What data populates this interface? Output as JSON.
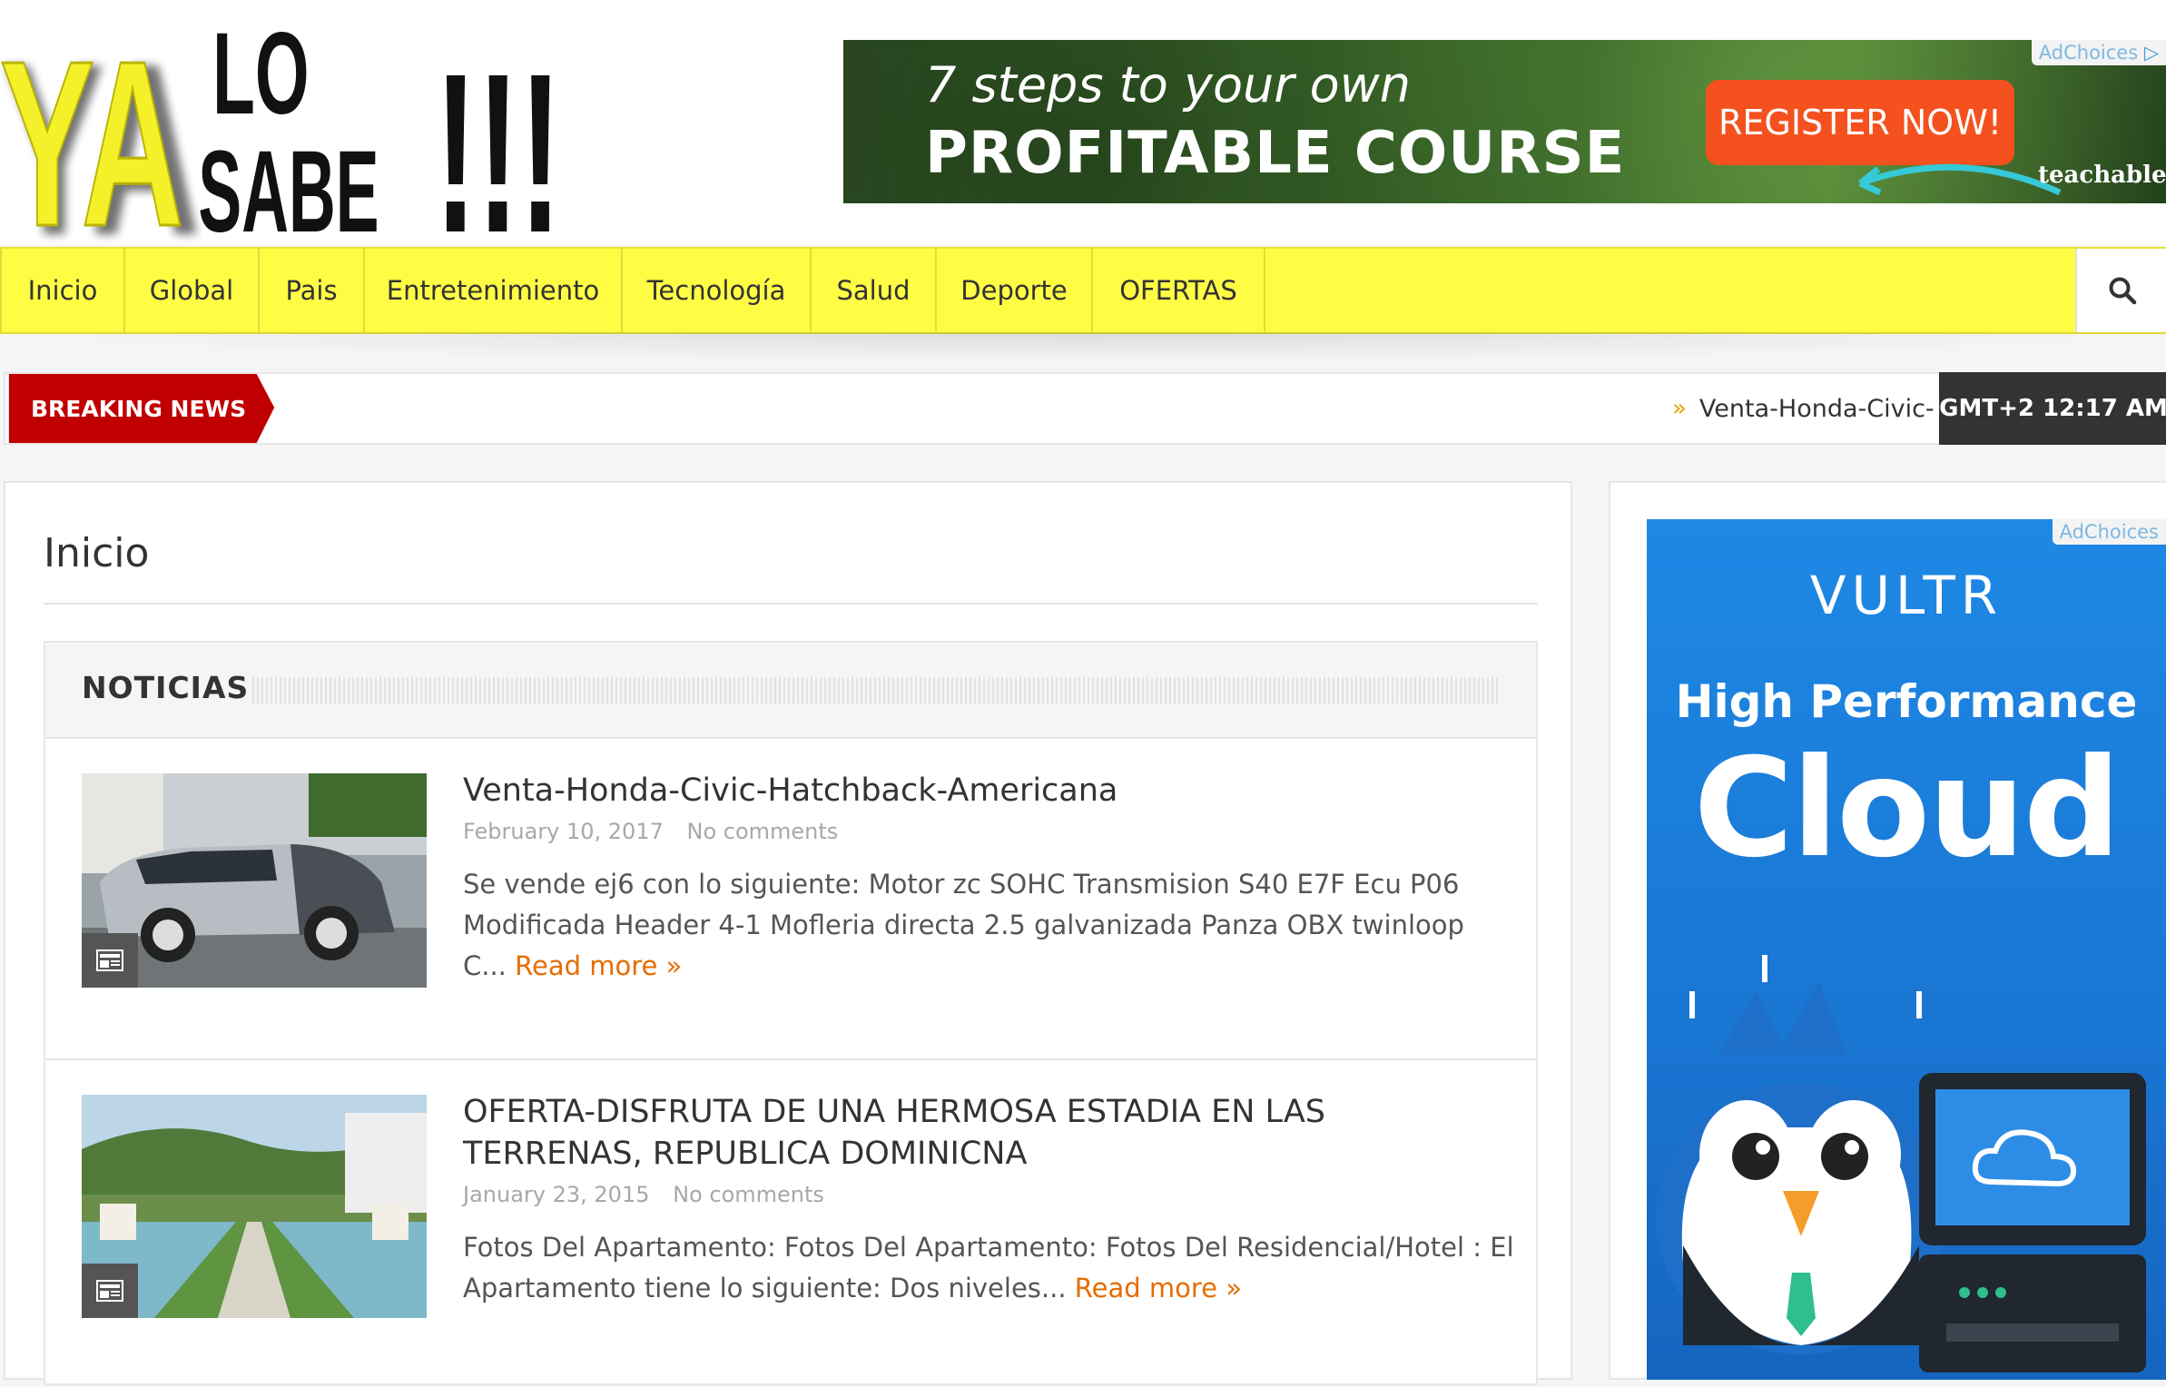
{
  "site": {
    "logo_text_ya": "YA",
    "logo_text_lo": "LO",
    "logo_text_sabe": "SABE",
    "logo_text_bangs": "!!!"
  },
  "top_ad": {
    "adchoices": "AdChoices",
    "line1": "7 steps to your own",
    "line2": "PROFITABLE COURSE",
    "button": "REGISTER NOW!",
    "brand": "teachable"
  },
  "nav": {
    "items": [
      {
        "label": "Inicio"
      },
      {
        "label": "Global"
      },
      {
        "label": "Pais"
      },
      {
        "label": "Entretenimiento"
      },
      {
        "label": "Tecnología"
      },
      {
        "label": "Salud"
      },
      {
        "label": "Deporte"
      },
      {
        "label": "OFERTAS"
      }
    ],
    "search_icon": "search-icon"
  },
  "breaking": {
    "label": "BREAKING NEWS",
    "ticker": "Venta-Honda-Civic-",
    "time": "GMT+2 12:17 AM",
    "colors": {
      "label_bg": "#c00000",
      "time_bg": "#333333"
    }
  },
  "main": {
    "page_title": "Inicio",
    "section_title": "NOTICIAS",
    "posts": [
      {
        "title": "Venta-Honda-Civic-Hatchback-Americana",
        "date": "February 10, 2017",
        "comments": "No comments",
        "excerpt": "  Se vende ej6 con lo siguiente: Motor zc SOHC Transmision S40 E7F Ecu P06 Modificada Header 4-1 Mofleria directa 2.5 galvanizada Panza OBX twinloop C...",
        "read_more": "Read more »"
      },
      {
        "title": "OFERTA-DISFRUTA DE UNA HERMOSA ESTADIA EN LAS TERRENAS, REPUBLICA DOMINICNA",
        "date": "January 23, 2015",
        "comments": "No comments",
        "excerpt": " Fotos Del Apartamento:   Fotos Del Apartamento:   Fotos Del Residencial/Hotel :       El Apartamento tiene lo siguiente: Dos niveles...",
        "read_more": "Read more »"
      }
    ]
  },
  "side_ad": {
    "adchoices": "AdChoices",
    "brand": "VULTR",
    "line1": "High Performance",
    "line2": "Cloud"
  },
  "colors": {
    "nav_bg": "#fffc44",
    "accent_orange": "#e56d00"
  }
}
